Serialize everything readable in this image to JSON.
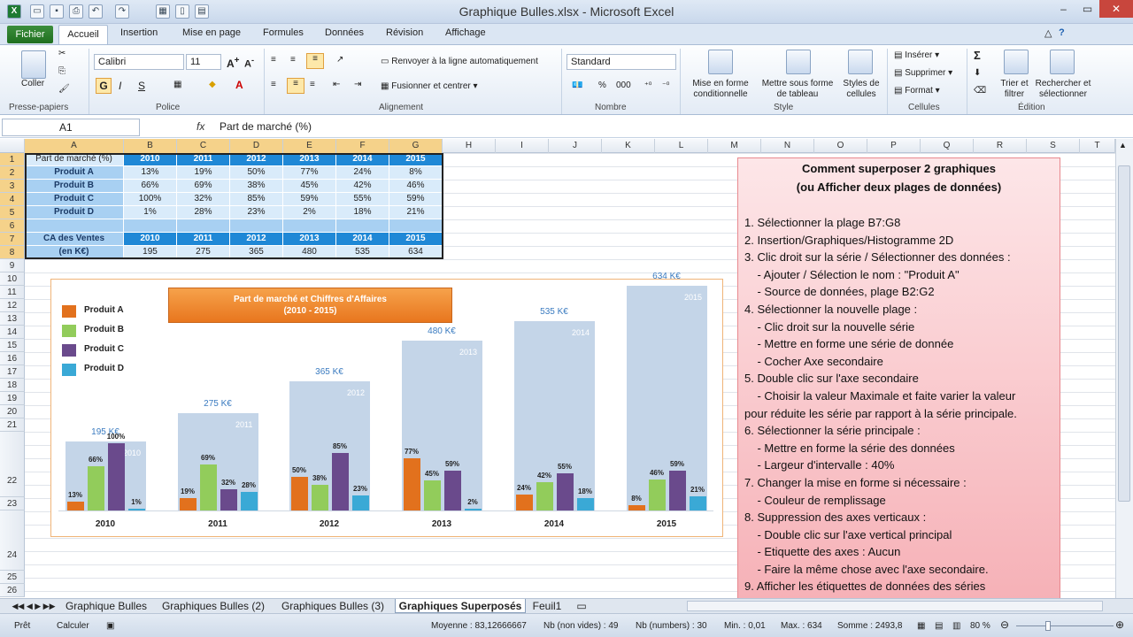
{
  "app": {
    "title": "Graphique Bulles.xlsx - Microsoft Excel"
  },
  "tabs": [
    "Fichier",
    "Accueil",
    "Insertion",
    "Mise en page",
    "Formules",
    "Données",
    "Révision",
    "Affichage"
  ],
  "ribbon": {
    "clipboard": {
      "paste": "Coller",
      "label": "Presse-papiers"
    },
    "font": {
      "name": "Calibri",
      "size": "11",
      "bold": "G",
      "italic": "I",
      "underline": "S",
      "label": "Police"
    },
    "alignment": {
      "wrap": "Renvoyer à la ligne automatiquement",
      "merge": "Fusionner et centrer",
      "label": "Alignement"
    },
    "number": {
      "format": "Standard",
      "percent": "%",
      "thousands": "000",
      "label": "Nombre"
    },
    "style": {
      "conditional": "Mise en forme conditionnelle",
      "table": "Mettre sous forme de tableau",
      "cellstyles": "Styles de cellules",
      "label": "Style"
    },
    "cells": {
      "insert": "Insérer",
      "delete": "Supprimer",
      "format": "Format",
      "label": "Cellules"
    },
    "editing": {
      "sort": "Trier et filtrer",
      "find": "Rechercher et sélectionner",
      "sum": "Σ",
      "label": "Édition"
    }
  },
  "formula": {
    "namebox": "A1",
    "fx": "fx",
    "content": "Part de marché (%)"
  },
  "columns": [
    "A",
    "B",
    "C",
    "D",
    "E",
    "F",
    "G",
    "H",
    "I",
    "J",
    "K",
    "L",
    "M",
    "N",
    "O",
    "P",
    "Q",
    "R",
    "S",
    "T"
  ],
  "rows": [
    "1",
    "2",
    "3",
    "4",
    "5",
    "6",
    "7",
    "8",
    "9",
    "10",
    "11",
    "12",
    "13",
    "14",
    "15",
    "16",
    "17",
    "18",
    "19",
    "20",
    "21",
    "22",
    "23",
    "24",
    "25",
    "26"
  ],
  "table1": {
    "header": [
      "Part de marché (%)",
      "2010",
      "2011",
      "2012",
      "2013",
      "2014",
      "2015"
    ],
    "rows": [
      [
        "Produit A",
        "13%",
        "19%",
        "50%",
        "77%",
        "24%",
        "8%"
      ],
      [
        "Produit B",
        "66%",
        "69%",
        "38%",
        "45%",
        "42%",
        "46%"
      ],
      [
        "Produit C",
        "100%",
        "32%",
        "85%",
        "59%",
        "55%",
        "59%"
      ],
      [
        "Produit D",
        "1%",
        "28%",
        "23%",
        "2%",
        "18%",
        "21%"
      ]
    ]
  },
  "table2": {
    "header": [
      "CA des Ventes",
      "2010",
      "2011",
      "2012",
      "2013",
      "2014",
      "2015"
    ],
    "row": [
      "(en K€)",
      "195",
      "275",
      "365",
      "480",
      "535",
      "634"
    ]
  },
  "chart_data": {
    "type": "bar",
    "title": "Part de marché et Chiffres d'Affaires\n(2010 - 2015)",
    "categories": [
      "2010",
      "2011",
      "2012",
      "2013",
      "2014",
      "2015"
    ],
    "secondary": {
      "name": "CA des Ventes",
      "values": [
        195,
        275,
        365,
        480,
        535,
        634
      ],
      "labels": [
        "195 K€",
        "275 K€",
        "365 K€",
        "480 K€",
        "535 K€",
        "634 K€"
      ]
    },
    "series": [
      {
        "name": "Produit A",
        "values": [
          13,
          19,
          50,
          77,
          24,
          8
        ],
        "color": "#e2711d"
      },
      {
        "name": "Produit B",
        "values": [
          66,
          69,
          38,
          45,
          42,
          46
        ],
        "color": "#92cc5b"
      },
      {
        "name": "Produit C",
        "values": [
          100,
          32,
          85,
          59,
          55,
          59
        ],
        "color": "#6a4a8c"
      },
      {
        "name": "Produit D",
        "values": [
          1,
          28,
          23,
          2,
          18,
          21
        ],
        "color": "#3aa9d6"
      }
    ],
    "legend": "left"
  },
  "note": {
    "title1": "Comment superposer 2 graphiques",
    "title2": "(ou Afficher deux plages de données)",
    "lines": [
      "1. Sélectionner la plage B7:G8",
      "2. Insertion/Graphiques/Histogramme 2D",
      "3. Clic droit sur la série / Sélectionner des données :",
      "    - Ajouter / Sélection le nom : \"Produit A\"",
      "    - Source de données, plage B2:G2",
      "4. Sélectionner la nouvelle plage :",
      "    - Clic droit sur la nouvelle série",
      "    - Mettre en forme une série de donnée",
      "    - Cocher Axe secondaire",
      "5. Double clic sur l'axe secondaire",
      "    - Choisir la valeur Maximale et faite varier la valeur",
      "pour réduite les série par rapport à la série principale.",
      "6. Sélectionner la série principale :",
      "    - Mettre en forme la série des données",
      "    - Largeur d'intervalle : 40%",
      "7. Changer la mise en forme si nécessaire :",
      "    - Couleur de remplissage",
      "8. Suppression des axes verticaux :",
      "    - Double clic sur l'axe vertical principal",
      "    - Etiquette des axes : Aucun",
      "    - Faire la même chose avec l'axe secondaire.",
      "9. Afficher les étiquettes de données des séries"
    ]
  },
  "sheets": [
    "Graphique Bulles",
    "Graphiques Bulles (2)",
    "Graphiques Bulles (3)",
    "Graphiques Superposés",
    "Feuil1"
  ],
  "status": {
    "ready": "Prêt",
    "calc": "Calculer",
    "avg": "Moyenne : 83,12666667",
    "count": "Nb (non vides) : 49",
    "numcount": "Nb (numbers) : 30",
    "min": "Min. : 0,01",
    "max": "Max. : 634",
    "sum": "Somme : 2493,8",
    "zoom": "80 %"
  }
}
